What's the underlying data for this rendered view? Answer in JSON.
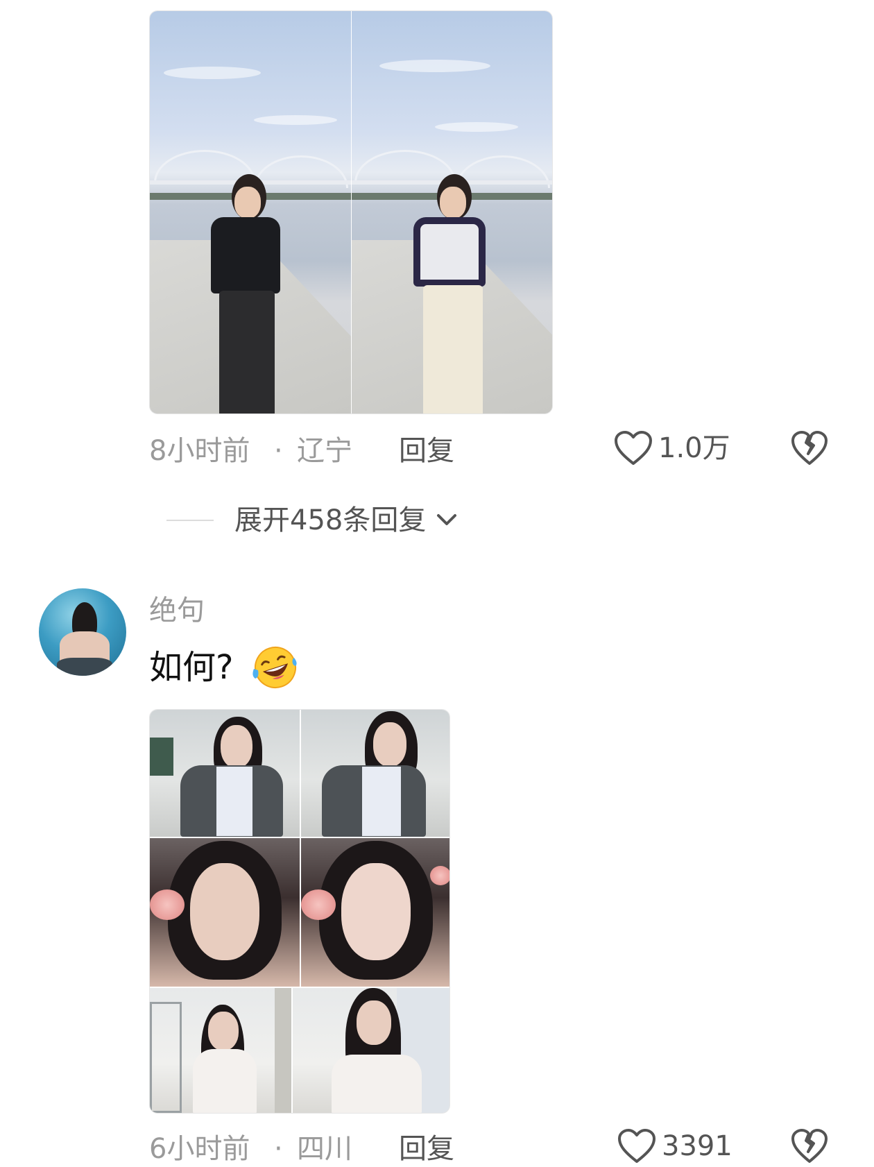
{
  "comments": [
    {
      "time": "8小时前",
      "location": "辽宁",
      "separator": "·",
      "reply_label": "回复",
      "like_count": "1.0万",
      "expand_label": "展开458条回复"
    },
    {
      "username": "绝句",
      "text": "如何?",
      "emoji": "rolling-on-floor-laughing-emoji",
      "time": "6小时前",
      "location": "四川",
      "separator": "·",
      "reply_label": "回复",
      "like_count": "3391"
    }
  ],
  "colors": {
    "meta_gray": "#9a9a9a",
    "action_gray": "#545454",
    "text_dark": "#111111",
    "background": "#ffffff"
  }
}
